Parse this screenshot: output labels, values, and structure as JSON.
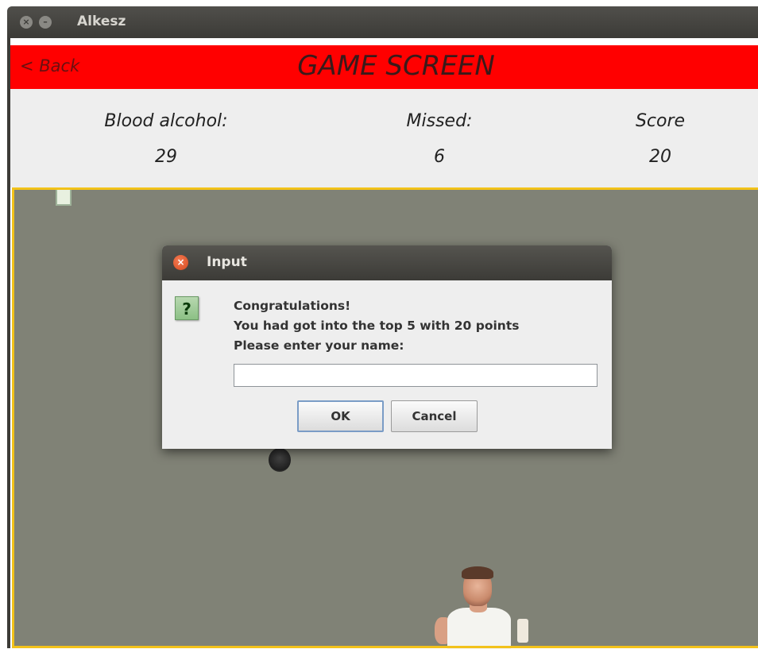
{
  "window": {
    "title": "Alkesz"
  },
  "header": {
    "back_label": "< Back",
    "title": "GAME SCREEN"
  },
  "stats": [
    {
      "label": "Blood alcohol:",
      "value": "29"
    },
    {
      "label": "Missed:",
      "value": "6"
    },
    {
      "label": "Score",
      "value": "20"
    }
  ],
  "dialog": {
    "title": "Input",
    "icon": "question-icon",
    "icon_glyph": "?",
    "close_glyph": "×",
    "message_lines": [
      "Congratulations!",
      "You had got into the top 5 with 20 points",
      "Please enter your name:"
    ],
    "input_value": "",
    "ok_label": "OK",
    "cancel_label": "Cancel"
  },
  "colors": {
    "header_bg": "#ff0000",
    "game_bg": "#808276",
    "game_border": "#f2c21a",
    "titlebar": "#3c3b37"
  }
}
